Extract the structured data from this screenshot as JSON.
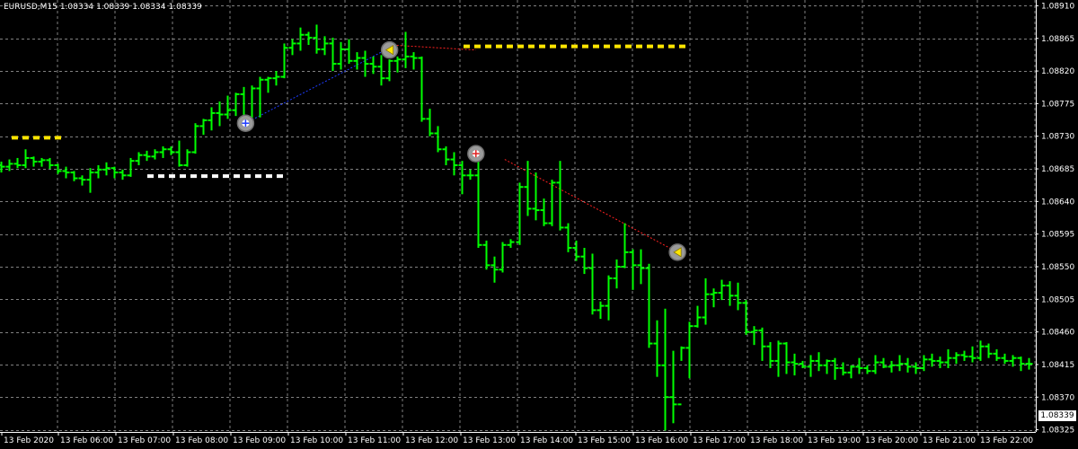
{
  "header": {
    "symbol": "EURUSD,M15",
    "open": "1.08334",
    "high": "1.08339",
    "low": "1.08334",
    "close": "1.08339"
  },
  "bid_label": "1.08339",
  "colors": {
    "background": "#000000",
    "grid": "#808080",
    "bar": "#00ff00",
    "text": "#ffffff",
    "level_yellow": "#ffe500",
    "level_white": "#ffffff",
    "trade_line_blue": "#1e3cff",
    "trade_line_red": "#ff2020"
  },
  "chart_data": {
    "type": "ohlc",
    "timeframe": "M15",
    "x_tick_labels": [
      "13 Feb 2020",
      "13 Feb 06:00",
      "13 Feb 07:00",
      "13 Feb 08:00",
      "13 Feb 09:00",
      "13 Feb 10:00",
      "13 Feb 11:00",
      "13 Feb 12:00",
      "13 Feb 13:00",
      "13 Feb 14:00",
      "13 Feb 15:00",
      "13 Feb 16:00",
      "13 Feb 17:00",
      "13 Feb 18:00",
      "13 Feb 19:00",
      "13 Feb 20:00",
      "13 Feb 21:00",
      "13 Feb 22:00"
    ],
    "y_tick_labels": [
      "1.08910",
      "1.08865",
      "1.08820",
      "1.08775",
      "1.08730",
      "1.08685",
      "1.08640",
      "1.08595",
      "1.08550",
      "1.08505",
      "1.08460",
      "1.08415",
      "1.08370",
      "1.08325"
    ],
    "ylim": [
      1.08322,
      1.08918
    ],
    "grid": true,
    "bars": [
      [
        1.0869,
        1.08695,
        1.0868,
        1.08688
      ],
      [
        1.08688,
        1.08698,
        1.08682,
        1.08692
      ],
      [
        1.08692,
        1.087,
        1.08686,
        1.0869
      ],
      [
        1.0869,
        1.08712,
        1.08686,
        1.087
      ],
      [
        1.087,
        1.08702,
        1.08688,
        1.08695
      ],
      [
        1.08695,
        1.087,
        1.08688,
        1.08697
      ],
      [
        1.08697,
        1.087,
        1.08685,
        1.0869
      ],
      [
        1.0869,
        1.08692,
        1.08678,
        1.08682
      ],
      [
        1.08682,
        1.08688,
        1.08672,
        1.0868
      ],
      [
        1.0868,
        1.08682,
        1.08668,
        1.08672
      ],
      [
        1.08672,
        1.08676,
        1.08662,
        1.0867
      ],
      [
        1.0867,
        1.08686,
        1.08652,
        1.0868
      ],
      [
        1.0868,
        1.0869,
        1.08672,
        1.08684
      ],
      [
        1.08684,
        1.08694,
        1.08676,
        1.08686
      ],
      [
        1.08686,
        1.08688,
        1.08672,
        1.0868
      ],
      [
        1.0868,
        1.08684,
        1.0867,
        1.08676
      ],
      [
        1.08676,
        1.087,
        1.08674,
        1.08696
      ],
      [
        1.08696,
        1.08708,
        1.0869,
        1.08704
      ],
      [
        1.08704,
        1.0871,
        1.08696,
        1.08702
      ],
      [
        1.08702,
        1.08712,
        1.08698,
        1.08708
      ],
      [
        1.08708,
        1.08716,
        1.087,
        1.08712
      ],
      [
        1.08712,
        1.08716,
        1.08704,
        1.08708
      ],
      [
        1.08708,
        1.08724,
        1.08688,
        1.0869
      ],
      [
        1.0869,
        1.08712,
        1.08688,
        1.08708
      ],
      [
        1.08708,
        1.08748,
        1.08706,
        1.08744
      ],
      [
        1.08744,
        1.08754,
        1.08732,
        1.08752
      ],
      [
        1.08752,
        1.0877,
        1.08738,
        1.08762
      ],
      [
        1.08762,
        1.08778,
        1.08744,
        1.0876
      ],
      [
        1.0876,
        1.08786,
        1.08754,
        1.08766
      ],
      [
        1.08766,
        1.0879,
        1.08758,
        1.08788
      ],
      [
        1.08788,
        1.08798,
        1.0875,
        1.08752
      ],
      [
        1.08752,
        1.088,
        1.0875,
        1.08796
      ],
      [
        1.08796,
        1.08812,
        1.08756,
        1.08808
      ],
      [
        1.08808,
        1.08812,
        1.0879,
        1.0881
      ],
      [
        1.0881,
        1.0882,
        1.088,
        1.08812
      ],
      [
        1.08812,
        1.08858,
        1.0881,
        1.08852
      ],
      [
        1.08852,
        1.08864,
        1.08842,
        1.08858
      ],
      [
        1.08858,
        1.0888,
        1.08848,
        1.0887
      ],
      [
        1.0887,
        1.08874,
        1.08856,
        1.08866
      ],
      [
        1.08866,
        1.08884,
        1.08844,
        1.0885
      ],
      [
        1.0885,
        1.08868,
        1.08842,
        1.08858
      ],
      [
        1.08858,
        1.08866,
        1.0882,
        1.0883
      ],
      [
        1.0883,
        1.0886,
        1.08822,
        1.0885
      ],
      [
        1.0885,
        1.08864,
        1.0883,
        1.08834
      ],
      [
        1.08834,
        1.08846,
        1.08822,
        1.08838
      ],
      [
        1.08838,
        1.08848,
        1.08812,
        1.0883
      ],
      [
        1.0883,
        1.0884,
        1.08816,
        1.08826
      ],
      [
        1.08826,
        1.08842,
        1.088,
        1.0881
      ],
      [
        1.0881,
        1.08836,
        1.08806,
        1.08834
      ],
      [
        1.08834,
        1.0884,
        1.08818,
        1.08836
      ],
      [
        1.08836,
        1.08874,
        1.08824,
        1.0884
      ],
      [
        1.0884,
        1.08846,
        1.08822,
        1.08838
      ],
      [
        1.08838,
        1.0884,
        1.0875,
        1.08754
      ],
      [
        1.08754,
        1.08768,
        1.0873,
        1.08734
      ],
      [
        1.08734,
        1.08744,
        1.08708,
        1.08712
      ],
      [
        1.08712,
        1.08716,
        1.0869,
        1.08698
      ],
      [
        1.08698,
        1.08708,
        1.08676,
        1.0869
      ],
      [
        1.0869,
        1.08696,
        1.0865,
        1.08676
      ],
      [
        1.08676,
        1.08684,
        1.0867,
        1.08676
      ],
      [
        1.08676,
        1.08696,
        1.08576,
        1.0858
      ],
      [
        1.0858,
        1.08586,
        1.08546,
        1.08552
      ],
      [
        1.08552,
        1.08564,
        1.08528,
        1.08546
      ],
      [
        1.08546,
        1.08584,
        1.08542,
        1.0858
      ],
      [
        1.0858,
        1.08588,
        1.08576,
        1.08584
      ],
      [
        1.08584,
        1.08666,
        1.0858,
        1.0866
      ],
      [
        1.0866,
        1.08696,
        1.0862,
        1.0863
      ],
      [
        1.0863,
        1.0868,
        1.08614,
        1.08628
      ],
      [
        1.08628,
        1.08644,
        1.08606,
        1.0861
      ],
      [
        1.0861,
        1.0867,
        1.08606,
        1.08666
      ],
      [
        1.08666,
        1.08696,
        1.086,
        1.08604
      ],
      [
        1.08604,
        1.0861,
        1.0857,
        1.08576
      ],
      [
        1.08576,
        1.08586,
        1.08558,
        1.08564
      ],
      [
        1.08564,
        1.08576,
        1.0854,
        1.08548
      ],
      [
        1.08548,
        1.08568,
        1.08484,
        1.0849
      ],
      [
        1.0849,
        1.08502,
        1.08478,
        1.08496
      ],
      [
        1.08496,
        1.08538,
        1.08476,
        1.08534
      ],
      [
        1.08534,
        1.0856,
        1.0852,
        1.0855
      ],
      [
        1.0855,
        1.0861,
        1.08548,
        1.0857
      ],
      [
        1.0857,
        1.08574,
        1.08518,
        1.08552
      ],
      [
        1.08552,
        1.08574,
        1.08526,
        1.08548
      ],
      [
        1.08548,
        1.08554,
        1.08438,
        1.08444
      ],
      [
        1.08444,
        1.08476,
        1.08398,
        1.08414
      ],
      [
        1.08414,
        1.08492,
        1.08324,
        1.0837
      ],
      [
        1.0837,
        1.08434,
        1.08334,
        1.0836
      ],
      [
        1.0836,
        1.0844,
        1.0842,
        1.08438
      ],
      [
        1.08438,
        1.08474,
        1.08396,
        1.08468
      ],
      [
        1.08468,
        1.08496,
        1.08466,
        1.0848
      ],
      [
        1.0848,
        1.08534,
        1.0847,
        1.08512
      ],
      [
        1.08512,
        1.0852,
        1.08494,
        1.08514
      ],
      [
        1.08514,
        1.08532,
        1.08504,
        1.08524
      ],
      [
        1.08524,
        1.0853,
        1.08496,
        1.0851
      ],
      [
        1.0851,
        1.08528,
        1.0849,
        1.085
      ],
      [
        1.085,
        1.08504,
        1.08456,
        1.0846
      ],
      [
        1.0846,
        1.08468,
        1.08442,
        1.08462
      ],
      [
        1.08462,
        1.08466,
        1.0842,
        1.0844
      ],
      [
        1.0844,
        1.08446,
        1.0841,
        1.0842
      ],
      [
        1.0842,
        1.08448,
        1.08398,
        1.08444
      ],
      [
        1.08444,
        1.08446,
        1.08402,
        1.08418
      ],
      [
        1.08418,
        1.0843,
        1.084,
        1.08416
      ],
      [
        1.08416,
        1.0842,
        1.0841,
        1.08412
      ],
      [
        1.08412,
        1.08428,
        1.08398,
        1.0842
      ],
      [
        1.0842,
        1.08432,
        1.08406,
        1.08414
      ],
      [
        1.08414,
        1.08422,
        1.08402,
        1.0842
      ],
      [
        1.0842,
        1.08424,
        1.08394,
        1.0841
      ],
      [
        1.0841,
        1.08418,
        1.084,
        1.08404
      ],
      [
        1.08404,
        1.08414,
        1.08396,
        1.08412
      ],
      [
        1.08412,
        1.08424,
        1.08402,
        1.0841
      ],
      [
        1.0841,
        1.08414,
        1.08402,
        1.08406
      ],
      [
        1.08406,
        1.08428,
        1.08402,
        1.08418
      ],
      [
        1.08418,
        1.08424,
        1.0841,
        1.08412
      ],
      [
        1.08412,
        1.0842,
        1.08404,
        1.08414
      ],
      [
        1.08414,
        1.08428,
        1.08406,
        1.08416
      ],
      [
        1.08416,
        1.08424,
        1.08404,
        1.08412
      ],
      [
        1.08412,
        1.08418,
        1.08402,
        1.0841
      ],
      [
        1.0841,
        1.08428,
        1.08406,
        1.08422
      ],
      [
        1.08422,
        1.0843,
        1.08412,
        1.0842
      ],
      [
        1.0842,
        1.08426,
        1.0841,
        1.08418
      ],
      [
        1.08418,
        1.08436,
        1.0841,
        1.08424
      ],
      [
        1.08424,
        1.08432,
        1.08416,
        1.08428
      ],
      [
        1.08428,
        1.08434,
        1.0842,
        1.08426
      ],
      [
        1.08426,
        1.0844,
        1.08418,
        1.08424
      ],
      [
        1.08424,
        1.08448,
        1.0842,
        1.0844
      ],
      [
        1.0844,
        1.08444,
        1.08424,
        1.0843
      ],
      [
        1.0843,
        1.08436,
        1.0842,
        1.08424
      ],
      [
        1.08424,
        1.0843,
        1.08416,
        1.0842
      ],
      [
        1.0842,
        1.08428,
        1.08412,
        1.08424
      ],
      [
        1.08424,
        1.08426,
        1.08406,
        1.08416
      ],
      [
        1.08416,
        1.08424,
        1.08408,
        1.08416
      ]
    ],
    "levels": [
      {
        "price": 1.08854,
        "from_bar": 32,
        "to_bar": 47,
        "style": "dashed-yellow"
      },
      {
        "price": 1.08728,
        "from_bar": -1,
        "to_bar": 0,
        "style": "dashed-yellow"
      },
      {
        "price": 1.08675,
        "from_bar": 10,
        "to_bar": 19,
        "style": "dashed-white"
      }
    ],
    "trade_lines": [
      {
        "from_bar": 8,
        "from_price": 1.08748,
        "to_bar": 13,
        "to_price": 1.08852,
        "color": "blue"
      },
      {
        "from_bar": 13,
        "from_price": 1.08856,
        "to_bar": 16,
        "to_price": 1.08849,
        "color": "red"
      },
      {
        "from_bar": 17,
        "from_price": 1.08698,
        "to_bar": 23,
        "to_price": 1.0857,
        "color": "red"
      }
    ],
    "markers": [
      {
        "bar": 8,
        "price": 1.08748,
        "type": "buy"
      },
      {
        "bar": 13,
        "price": 1.08849,
        "type": "close"
      },
      {
        "bar": 16,
        "price": 1.08706,
        "type": "sell"
      },
      {
        "bar": 23,
        "price": 1.0857,
        "type": "close"
      }
    ]
  }
}
